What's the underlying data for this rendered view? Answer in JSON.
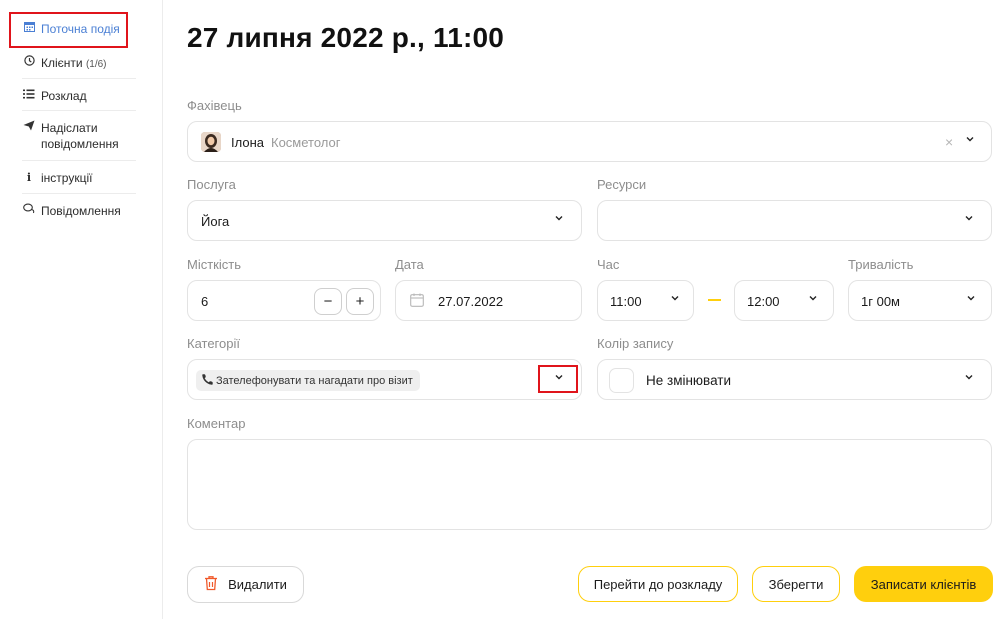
{
  "sidebar": {
    "items": [
      {
        "label": "Поточна подія",
        "icon": "calendar-icon"
      },
      {
        "label": "Клієнти",
        "count": "(1/6)",
        "icon": "clock-icon"
      },
      {
        "label": "Розклад",
        "icon": "list-icon"
      },
      {
        "label": "Надіслати повідомлення",
        "icon": "send-icon"
      },
      {
        "label": "інструкції",
        "icon": "info-icon"
      },
      {
        "label": "Повідомлення",
        "icon": "chat-icon"
      }
    ]
  },
  "page": {
    "title": "27 липня 2022 р., 11:00"
  },
  "form": {
    "specialist": {
      "label": "Фахівець",
      "name": "Ілона",
      "role": "Косметолог"
    },
    "service": {
      "label": "Послуга",
      "value": "Йога"
    },
    "resources": {
      "label": "Ресурси",
      "value": ""
    },
    "capacity": {
      "label": "Місткість",
      "value": "6",
      "minus": "−",
      "plus": "+"
    },
    "date": {
      "label": "Дата",
      "value": "27.07.2022"
    },
    "time": {
      "label": "Час",
      "start": "11:00",
      "end": "12:00"
    },
    "duration": {
      "label": "Тривалість",
      "value": "1г 00м"
    },
    "categories": {
      "label": "Категорії",
      "tag": "Зателефонувати та нагадати про візит"
    },
    "color": {
      "label": "Колір запису",
      "value": "Не змінювати"
    },
    "comment": {
      "label": "Коментар",
      "value": ""
    }
  },
  "actions": {
    "delete": "Видалити",
    "go_schedule": "Перейти до розкладу",
    "save": "Зберегти",
    "record_clients": "Записати клієнтів"
  },
  "colors": {
    "accent_yellow": "#ffcf0d",
    "highlight_red": "#e0141b",
    "active_blue": "#4a7fd4"
  }
}
